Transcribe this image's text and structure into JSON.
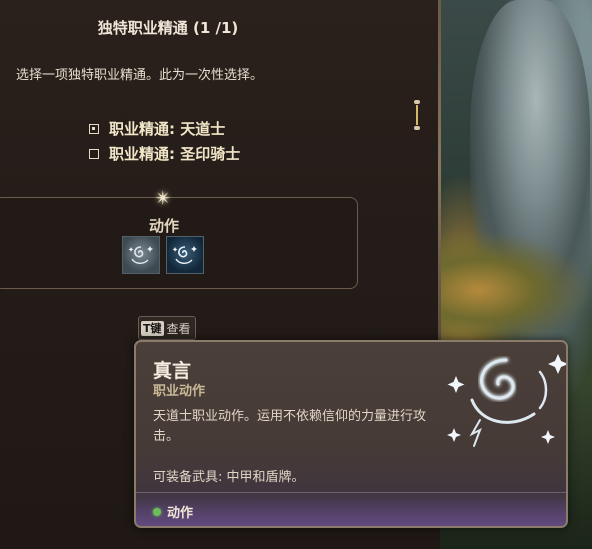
{
  "panel": {
    "title": "独特职业精通 (1 /1)",
    "subtitle": "选择一项独特职业精通。此为一次性选择。",
    "options": [
      {
        "label": "职业精通: 天道士",
        "checked": true
      },
      {
        "label": "职业精通: 圣印骑士",
        "checked": false
      }
    ],
    "actions_label": "动作",
    "action_icons": [
      "swirl-spell-icon",
      "swirl-spell-icon-selected"
    ]
  },
  "key_hint": {
    "key": "T键",
    "label": "查看"
  },
  "tooltip": {
    "title": "真言",
    "subtitle": "职业动作",
    "description": "天道士职业动作。运用不依赖信仰的力量进行攻击。",
    "equip": "可装备武具: 中甲和盾牌。",
    "tag": "动作",
    "tag_color": "#6bbf5a",
    "art_icon": "swirl-sparkle-icon"
  },
  "colors": {
    "panel_bg": "#241c18",
    "frame": "#6d5c4b",
    "accent_gold": "#d2b868"
  }
}
